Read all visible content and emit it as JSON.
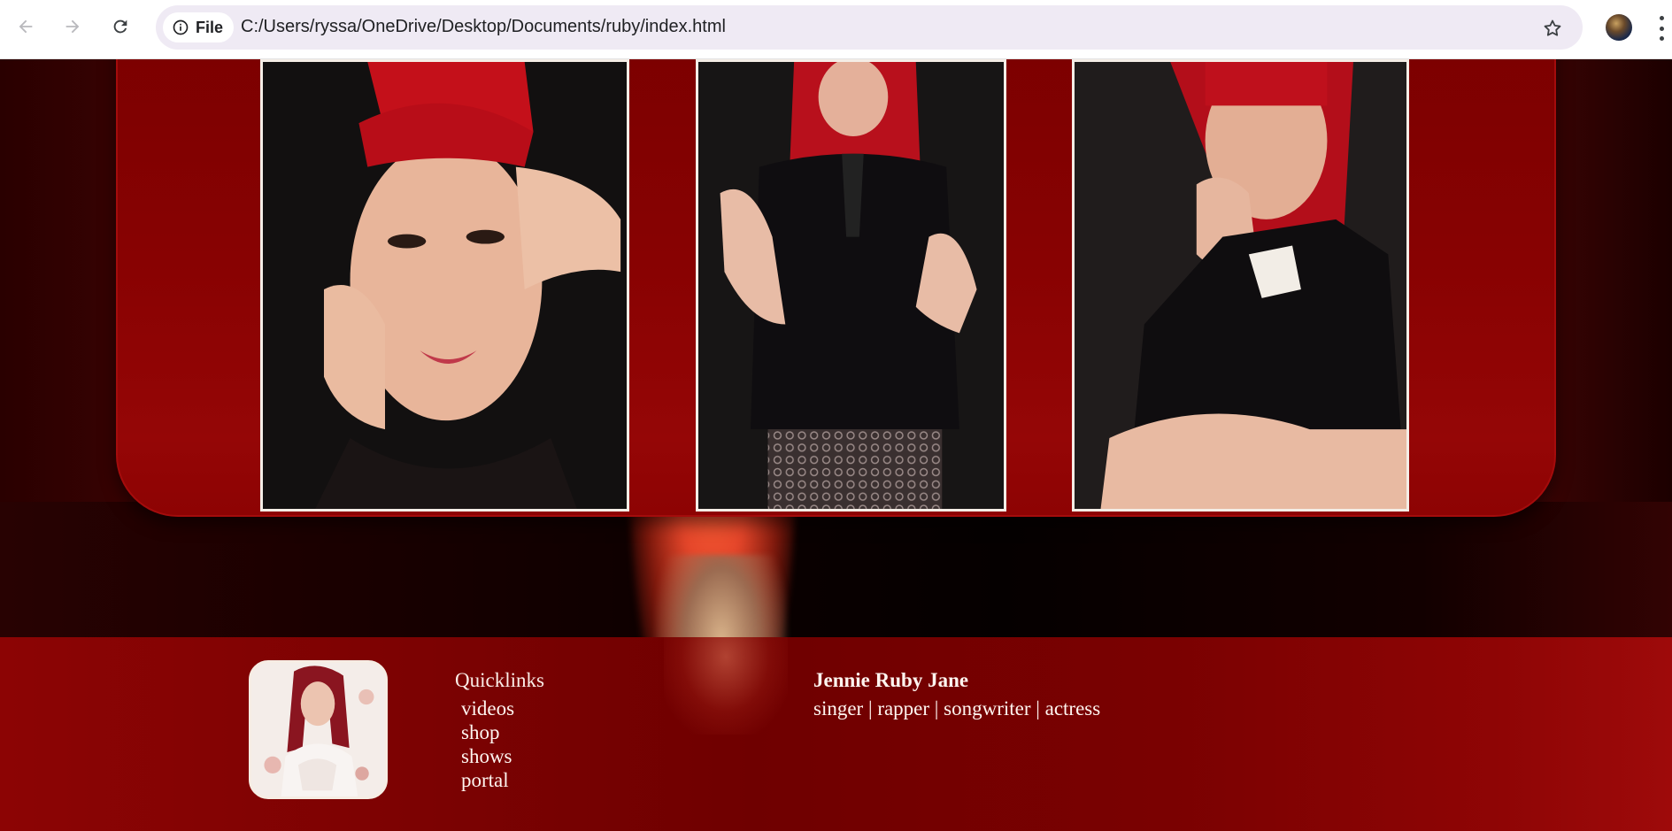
{
  "browser": {
    "site_chip_label": "File",
    "url": "C:/Users/ryssa/OneDrive/Desktop/Documents/ruby/index.html",
    "icons": [
      "back-arrow-icon",
      "forward-arrow-icon",
      "reload-icon",
      "info-icon",
      "star-icon",
      "profile-avatar",
      "more-menu-icon"
    ]
  },
  "gallery": {
    "photos": [
      {
        "name": "photo-face-hands"
      },
      {
        "name": "photo-black-outfit-seated"
      },
      {
        "name": "photo-hand-on-chin"
      }
    ]
  },
  "footer": {
    "quicklinks_title": "Quicklinks",
    "quicklinks": [
      "videos",
      "shop",
      "shows",
      "portal"
    ],
    "artist_name": "Jennie Ruby Jane",
    "artist_roles": "singer | rapper | songwriter | actress"
  },
  "colors": {
    "card_red": "#880202",
    "footer_red": "#7c0202",
    "photo_border": "#f4ede6",
    "text_light": "#fff5f0"
  }
}
